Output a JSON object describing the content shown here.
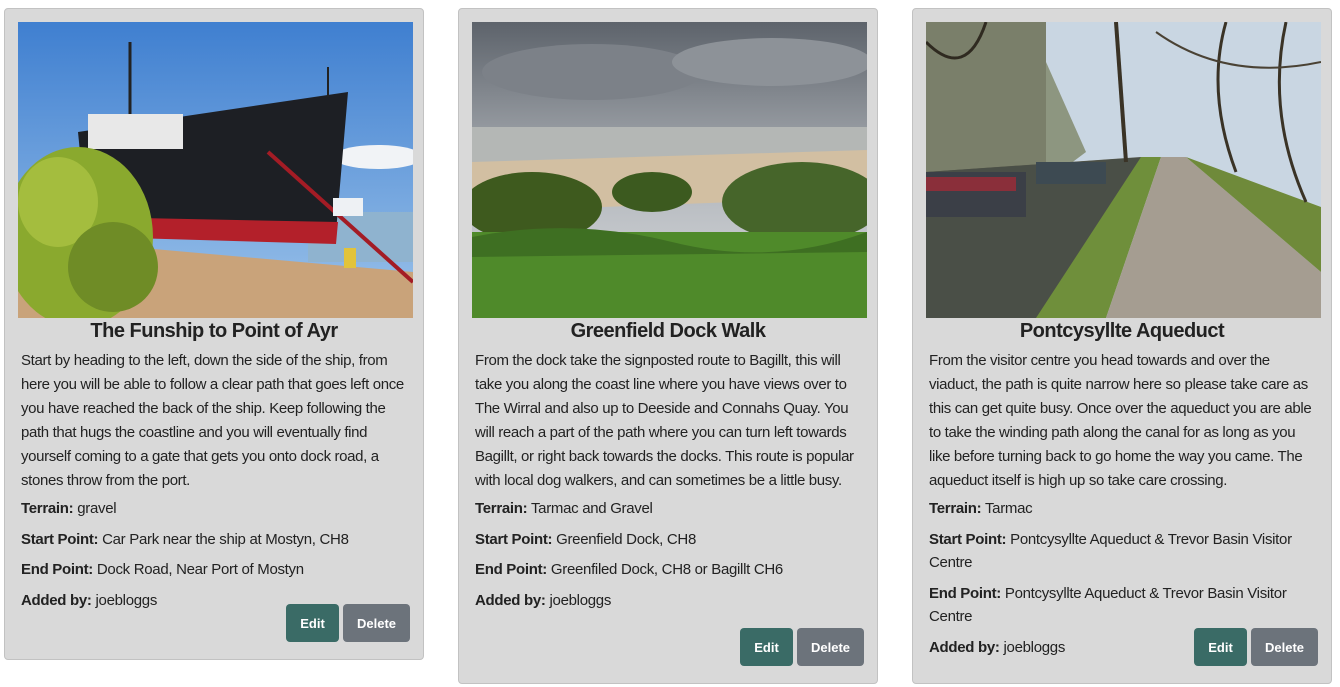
{
  "walks": [
    {
      "title": "The Funship to Point of Ayr",
      "image_alt": "Black ship docked on sandy shore with green shrub",
      "description": "Start by heading to the left, down the side of the ship, from here you will be able to follow a clear path that goes left once you have reached the back of the ship. Keep following the path that hugs the coastline and you will eventually find yourself coming to a gate that gets you onto dock road, a stones throw from the port.",
      "terrain_label": "Terrain:",
      "terrain": "gravel",
      "start_label": "Start Point:",
      "start": "Car Park near the ship at Mostyn, CH8",
      "end_label": "End Point:",
      "end": "Dock Road, Near Port of Mostyn",
      "added_label": "Added by:",
      "added_by": "joebloggs",
      "edit_label": "Edit",
      "delete_label": "Delete"
    },
    {
      "title": "Greenfield Dock Walk",
      "image_alt": "Estuary beach under cloudy sky with green grass",
      "description": "From the dock take the signposted route to Bagillt, this will take you along the coast line where you have views over to The Wirral and also up to Deeside and Connahs Quay. You will reach a part of the path where you can turn left towards Bagillt, or right back towards the docks. This route is popular with local dog walkers, and can sometimes be a little busy.",
      "terrain_label": "Terrain:",
      "terrain": "Tarmac and Gravel",
      "start_label": "Start Point:",
      "start": "Greenfield Dock, CH8",
      "end_label": "End Point:",
      "end": "Greenfiled Dock, CH8 or Bagillt CH6",
      "added_label": "Added by:",
      "added_by": "joebloggs",
      "edit_label": "Edit",
      "delete_label": "Delete"
    },
    {
      "title": "Pontcysyllte Aqueduct",
      "image_alt": "Canal with narrowboats and towpath under trees",
      "description": "From the visitor centre you head towards and over the viaduct, the path is quite narrow here so please take care as this can get quite busy. Once over the aqueduct you are able to take the winding path along the canal for as long as you like before turning back to go home the way you came. The aqueduct itself is high up so take care crossing.",
      "terrain_label": "Terrain:",
      "terrain": "Tarmac",
      "start_label": "Start Point:",
      "start": "Pontcysyllte Aqueduct & Trevor Basin Visitor Centre",
      "end_label": "End Point:",
      "end": "Pontcysyllte Aqueduct & Trevor Basin Visitor Centre",
      "added_label": "Added by:",
      "added_by": "joebloggs",
      "edit_label": "Edit",
      "delete_label": "Delete"
    }
  ],
  "colors": {
    "card_bg": "#d9d9d9",
    "edit_button": "#3a6b66",
    "delete_button": "#6c737b"
  }
}
